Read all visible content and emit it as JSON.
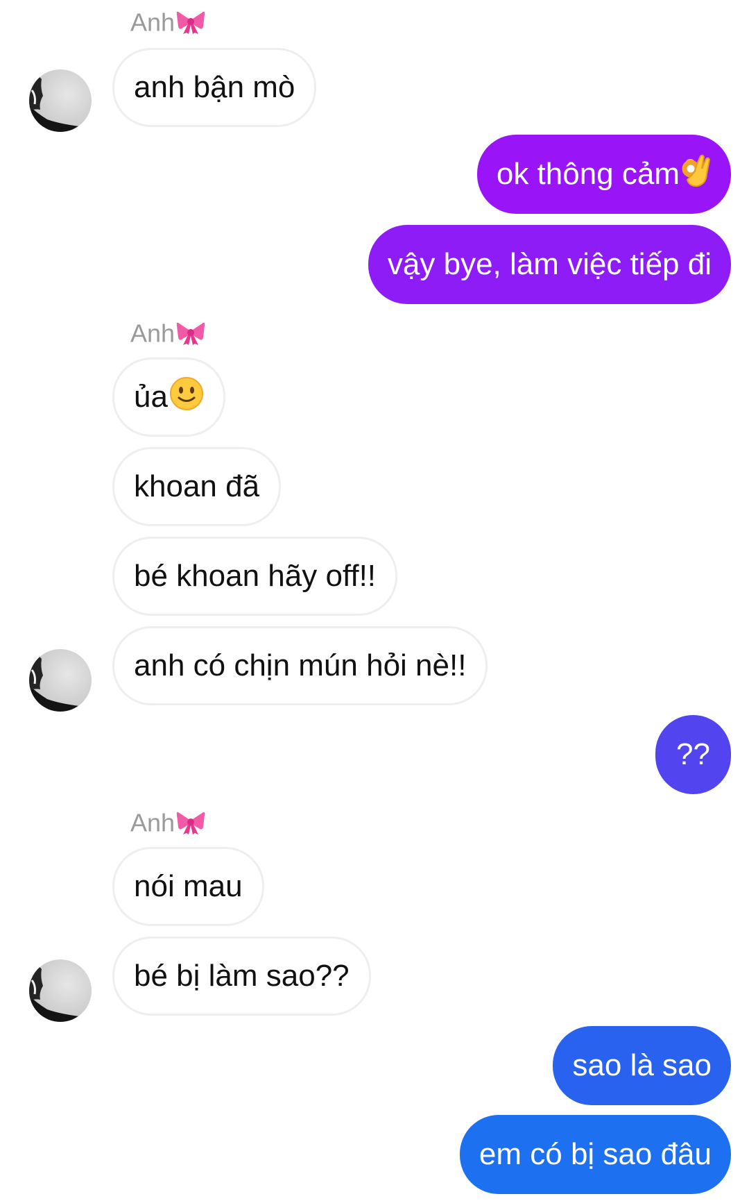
{
  "sender_name": "Anh",
  "colors": {
    "outgoing_top": "#9a14f8",
    "outgoing_mid": "#5244ee",
    "outgoing_bottom": "#1d70f0",
    "incoming_border": "#eeeeee",
    "name_gray": "#9a9a9a"
  },
  "messages": [
    {
      "from": "other",
      "text": "anh bận mò"
    },
    {
      "from": "me",
      "text": "ok thông cảm",
      "emoji": "ok-hand-icon"
    },
    {
      "from": "me",
      "text": "vậy bye, làm việc tiếp đi"
    },
    {
      "from": "other",
      "text": "ủa",
      "emoji": "slightly-smiling-face-icon"
    },
    {
      "from": "other",
      "text": "khoan đã"
    },
    {
      "from": "other",
      "text": "bé khoan hãy off!!"
    },
    {
      "from": "other",
      "text": "anh có chịn mún hỏi nè!!"
    },
    {
      "from": "me",
      "text": "??"
    },
    {
      "from": "other",
      "text": "nói mau"
    },
    {
      "from": "other",
      "text": "bé bị làm sao??"
    },
    {
      "from": "me",
      "text": "sao là sao"
    },
    {
      "from": "me",
      "text": "em có bị sao đâu"
    }
  ]
}
